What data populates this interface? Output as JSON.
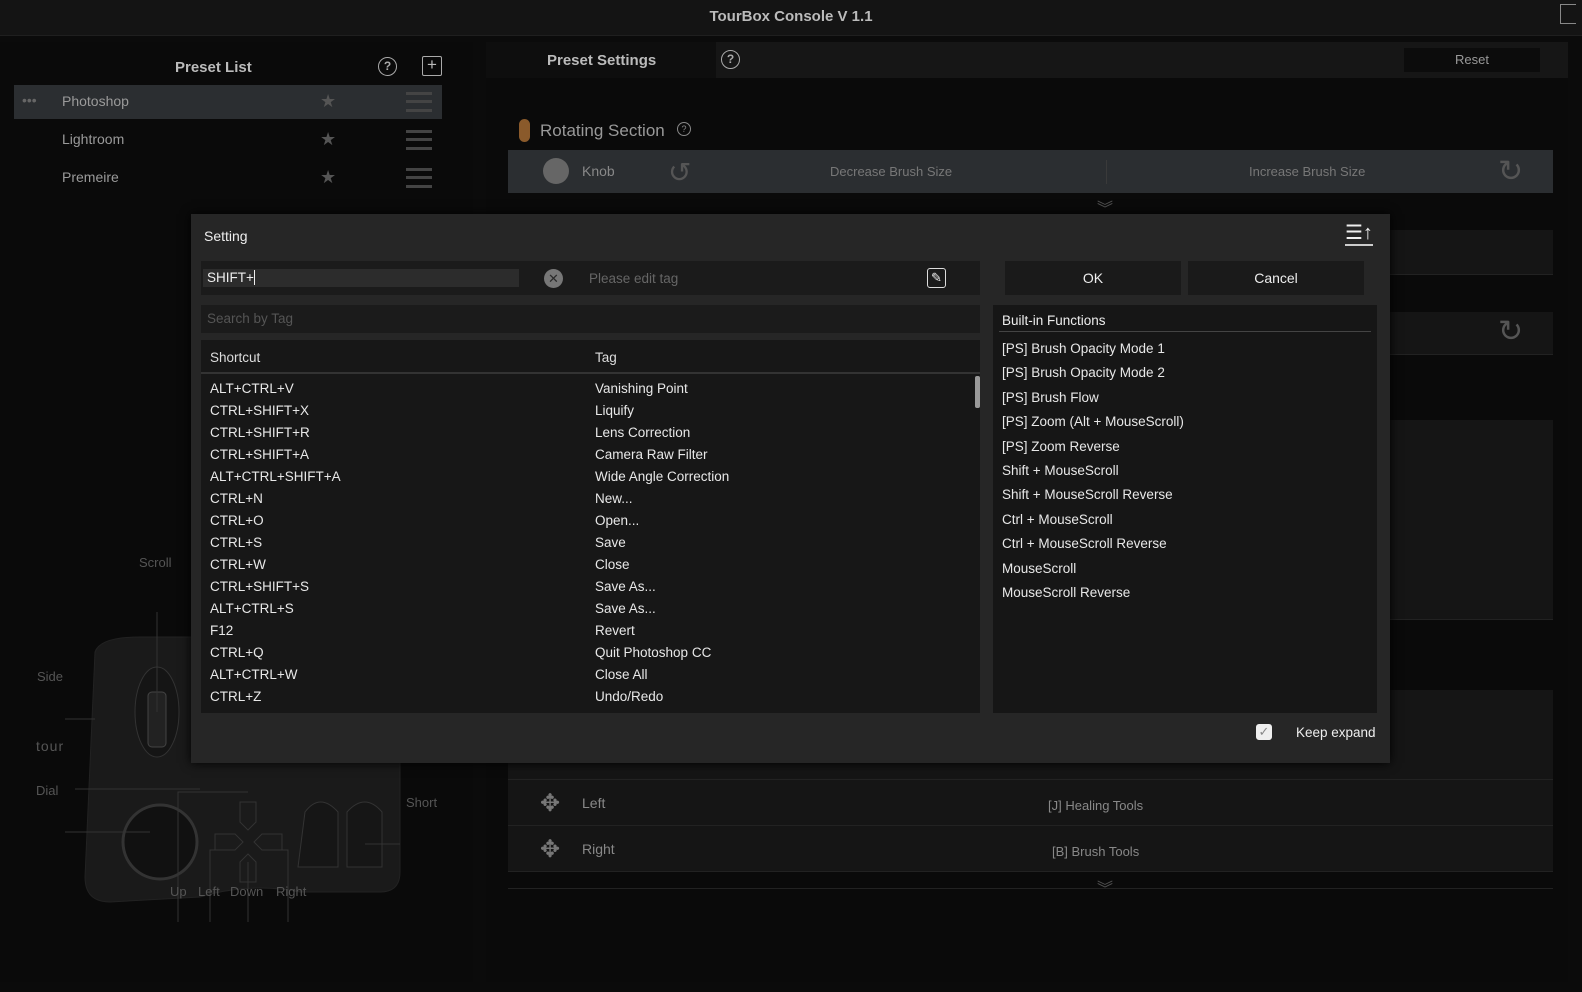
{
  "window": {
    "title": "TourBox Console V 1.1"
  },
  "preset_list": {
    "title": "Preset List",
    "items": [
      {
        "label": "Photoshop",
        "selected": true
      },
      {
        "label": "Lightroom"
      },
      {
        "label": "Premeire"
      }
    ]
  },
  "preset_settings": {
    "title": "Preset Settings",
    "reset": "Reset",
    "rotating_section": "Rotating Section",
    "knob": {
      "label": "Knob",
      "left": "Decrease Brush Size",
      "right": "Increase Brush Size"
    },
    "rows": [
      {
        "label": "Left",
        "value": "[J] Healing Tools"
      },
      {
        "label": "Right",
        "value": "[B] Brush Tools"
      }
    ]
  },
  "device": {
    "labels": {
      "scroll": "Scroll",
      "side": "Side",
      "tour": "tour",
      "dial": "Dial",
      "short": "Short",
      "up": "Up",
      "left": "Left",
      "down": "Down",
      "right": "Right"
    }
  },
  "dialog": {
    "title": "Setting",
    "shortcut_value": "SHIFT+",
    "tag_placeholder": "Please edit tag",
    "search_placeholder": "Search by Tag",
    "ok": "OK",
    "cancel": "Cancel",
    "columns": {
      "shortcut": "Shortcut",
      "tag": "Tag"
    },
    "rows": [
      [
        "ALT+CTRL+V",
        "Vanishing Point"
      ],
      [
        "CTRL+SHIFT+X",
        "Liquify"
      ],
      [
        "CTRL+SHIFT+R",
        "Lens Correction"
      ],
      [
        "CTRL+SHIFT+A",
        "Camera Raw Filter"
      ],
      [
        "ALT+CTRL+SHIFT+A",
        "Wide Angle Correction"
      ],
      [
        "CTRL+N",
        "New..."
      ],
      [
        "CTRL+O",
        "Open..."
      ],
      [
        "CTRL+S",
        "Save"
      ],
      [
        "CTRL+W",
        "Close"
      ],
      [
        "CTRL+SHIFT+S",
        "Save As..."
      ],
      [
        "ALT+CTRL+S",
        "Save As..."
      ],
      [
        "F12",
        "Revert"
      ],
      [
        "CTRL+Q",
        "Quit Photoshop CC"
      ],
      [
        "ALT+CTRL+W",
        "Close All"
      ],
      [
        "CTRL+Z",
        "Undo/Redo"
      ]
    ],
    "builtin_title": "Built-in Functions",
    "builtin": [
      "[PS] Brush Opacity Mode 1",
      "[PS] Brush Opacity Mode 2",
      "[PS] Brush Flow",
      "[PS] Zoom (Alt + MouseScroll)",
      "[PS] Zoom Reverse",
      "Shift + MouseScroll",
      "Shift + MouseScroll Reverse",
      "Ctrl + MouseScroll",
      "Ctrl + MouseScroll Reverse",
      "MouseScroll",
      "MouseScroll Reverse"
    ],
    "keep_expand": "Keep expand",
    "keep_expand_checked": true
  },
  "colors": {
    "accent": "#8a5a2b"
  }
}
